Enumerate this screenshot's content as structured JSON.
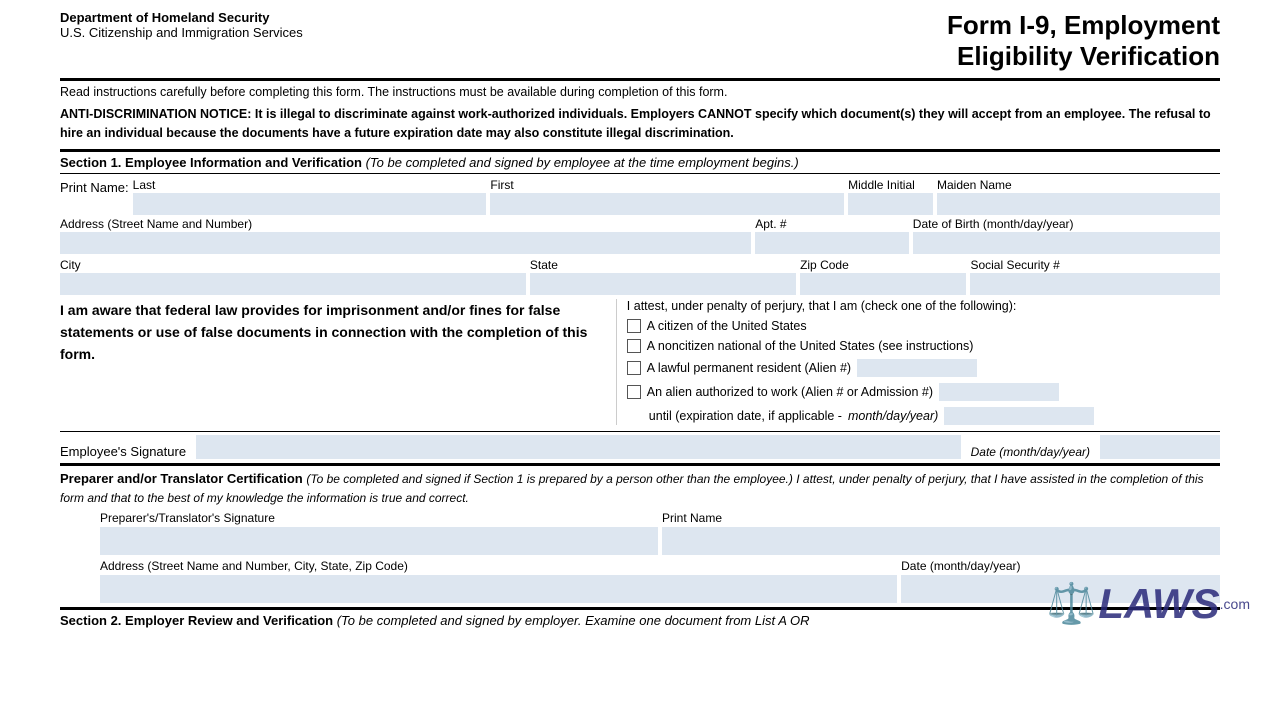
{
  "header": {
    "dept": "Department of Homeland Security",
    "agency": "U.S. Citizenship and Immigration Services",
    "form_title": "Form I-9, Employment",
    "form_subtitle": "Eligibility Verification"
  },
  "notices": {
    "read_instructions": "Read instructions carefully before completing this form.  The instructions must be available during completion of this form.",
    "anti_disc": "ANTI-DISCRIMINATION NOTICE:  It is illegal to discriminate against work-authorized individuals. Employers CANNOT specify which document(s) they will accept from an employee.  The refusal to hire an individual because the documents have  a future expiration date may also constitute illegal discrimination."
  },
  "section1": {
    "header": "Section 1. Employee Information and Verification",
    "header_italic": "(To be completed and signed by employee at the time employment begins.)",
    "print_name_label": "Print Name:",
    "last_label": "Last",
    "first_label": "First",
    "middle_initial_label": "Middle Initial",
    "maiden_name_label": "Maiden Name",
    "address_label": "Address (Street Name and Number)",
    "apt_label": "Apt. #",
    "dob_label": "Date of Birth (month/day/year)",
    "city_label": "City",
    "state_label": "State",
    "zip_label": "Zip Code",
    "ssn_label": "Social Security #",
    "awareness_text": "I am aware that federal law provides for imprisonment and/or fines for false statements or use of false documents in connection with the completion of this form.",
    "attest_title": "I attest, under penalty of perjury, that I am (check one of the following):",
    "checkbox1": "A citizen of the United States",
    "checkbox2": "A noncitizen national of the United States (see instructions)",
    "checkbox3": "A lawful permanent resident (Alien #)",
    "checkbox4": "An alien authorized to work (Alien # or Admission #)",
    "until_line": "until (expiration date, if applicable -",
    "until_italic": "month/day/year)",
    "employee_sig_label": "Employee's Signature",
    "date_label": "Date (month/day/year)"
  },
  "preparer": {
    "header_bold": "Preparer and/or Translator Certification",
    "header_italic": "(To be completed and signed if Section 1 is prepared by a person other than the employee.) I attest, under penalty of perjury, that I have assisted in the completion of this form and that to the best of my knowledge the information is true and correct.",
    "sig_label": "Preparer's/Translator's Signature",
    "print_name_label": "Print Name",
    "address_label": "Address (Street Name and Number, City, State, Zip Code)",
    "date_label": "Date (month/day/year)"
  },
  "section2": {
    "header": "Section 2. Employer Review and Verification",
    "header_italic": "(To be completed and signed by employer. Examine one document from List A OR"
  }
}
